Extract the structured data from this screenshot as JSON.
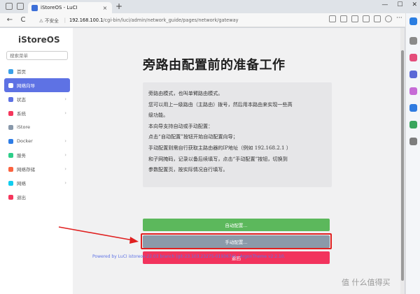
{
  "browser": {
    "tab_title": "iStoreOS - LuCI",
    "tab_close": "×",
    "new_tab": "+",
    "back": "←",
    "reload": "C",
    "security_warning": "⚠ 不安全",
    "url_host": "192.168.100.1",
    "url_path": "/cgi-bin/luci/admin/network_guide/pages/network/gateway",
    "window_minimize": "—",
    "window_maximize": "☐",
    "window_close": "✕"
  },
  "sidebar": {
    "brand": "iStoreOS",
    "search_placeholder": "搜索菜单",
    "items": [
      {
        "label": "首页",
        "active": false,
        "has_children": false,
        "icon_color": "#3aa0e8"
      },
      {
        "label": "网络向导",
        "active": true,
        "has_children": false,
        "icon_color": "#ffffff"
      },
      {
        "label": "状态",
        "active": false,
        "has_children": true,
        "icon_color": "#5e72e4"
      },
      {
        "label": "系统",
        "active": false,
        "has_children": true,
        "icon_color": "#f5365c"
      },
      {
        "label": "iStore",
        "active": false,
        "has_children": false,
        "icon_color": "#8898aa"
      },
      {
        "label": "Docker",
        "active": false,
        "has_children": true,
        "icon_color": "#2e7de6"
      },
      {
        "label": "服务",
        "active": false,
        "has_children": true,
        "icon_color": "#2dce89"
      },
      {
        "label": "网络存储",
        "active": false,
        "has_children": true,
        "icon_color": "#fb6340"
      },
      {
        "label": "网络",
        "active": false,
        "has_children": true,
        "icon_color": "#11cdef"
      },
      {
        "label": "退出",
        "active": false,
        "has_children": false,
        "icon_color": "#f5365c"
      }
    ]
  },
  "main": {
    "title": "旁路由配置前的准备工作",
    "description_lines": [
      "旁路由模式，也叫单臂路由模式。",
      "您可以用上一级路由（主路由）拨号，然后用本路由来实现一些高",
      "级功能。",
      "本向导支持自动或手动配置：",
      "点击“自动配置”按钮开始自动配置向导；",
      "手动配置则需自行获取主路由器的IP地址（例如 192.168.2.1 ）",
      "和子网掩码，记录以备后续填写，点击“手动配置”按钮，切换到",
      "参数配置页，按实际情况自行填写。"
    ],
    "buttons": {
      "auto": "自动配置...",
      "manual": "手动配置...",
      "back": "返回"
    },
    "footer": "Powered by LuCI istoreos-22.03 branch (git-23.103.23275-0193674) / ArgonTheme v2.2.10."
  },
  "watermark": "值 什么值得买",
  "colors": {
    "accent": "#5e72e4",
    "success": "#5cb85c",
    "secondary": "#8b9aa9",
    "danger": "#f2335d",
    "highlight": "#e02020"
  }
}
